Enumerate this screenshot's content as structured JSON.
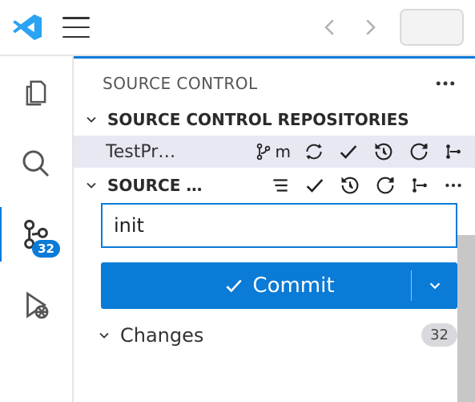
{
  "accent": "#0a7bd6",
  "activity": {
    "scm_badge": "32"
  },
  "panel": {
    "title": "SOURCE CONTROL",
    "repos_label": "SOURCE CONTROL REPOSITORIES",
    "repo_name": "TestPr…",
    "branch_short": "m",
    "sc_label": "SOURCE …",
    "commit_input": "init",
    "commit_button": "Commit",
    "changes_label": "Changes",
    "changes_count": "32"
  }
}
